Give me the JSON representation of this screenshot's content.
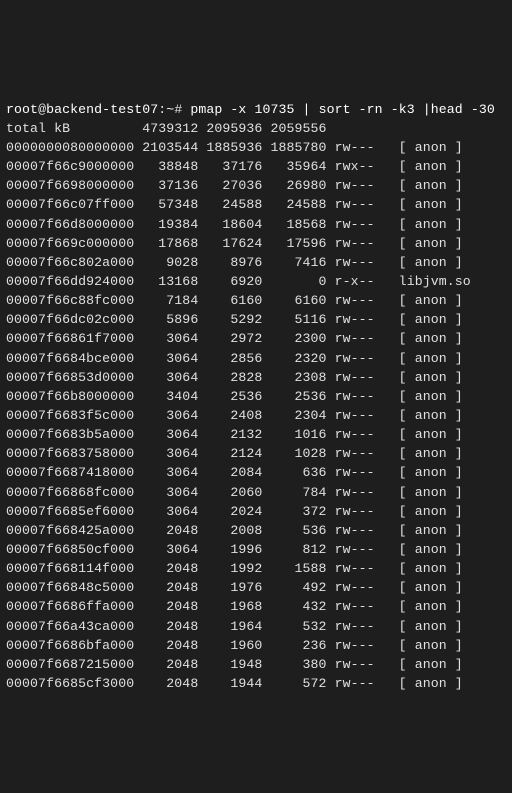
{
  "prompt": {
    "user": "root",
    "host": "backend-test07",
    "path": "~",
    "symbol": "#",
    "command": "pmap -x 10735 | sort -rn -k3 |head -30"
  },
  "header": {
    "label": "total kB",
    "c1": "4739312",
    "c2": "2095936",
    "c3": "2059556"
  },
  "rows": [
    {
      "addr": "0000000080000000",
      "c1": "2103544",
      "c2": "1885936",
      "c3": "1885780",
      "mode": "rw---",
      "map": "[ anon ]"
    },
    {
      "addr": "00007f66c9000000",
      "c1": "38848",
      "c2": "37176",
      "c3": "35964",
      "mode": "rwx--",
      "map": "[ anon ]"
    },
    {
      "addr": "00007f6698000000",
      "c1": "37136",
      "c2": "27036",
      "c3": "26980",
      "mode": "rw---",
      "map": "[ anon ]"
    },
    {
      "addr": "00007f66c07ff000",
      "c1": "57348",
      "c2": "24588",
      "c3": "24588",
      "mode": "rw---",
      "map": "[ anon ]"
    },
    {
      "addr": "00007f66d8000000",
      "c1": "19384",
      "c2": "18604",
      "c3": "18568",
      "mode": "rw---",
      "map": "[ anon ]"
    },
    {
      "addr": "00007f669c000000",
      "c1": "17868",
      "c2": "17624",
      "c3": "17596",
      "mode": "rw---",
      "map": "[ anon ]"
    },
    {
      "addr": "00007f66c802a000",
      "c1": "9028",
      "c2": "8976",
      "c3": "7416",
      "mode": "rw---",
      "map": "[ anon ]"
    },
    {
      "addr": "00007f66dd924000",
      "c1": "13168",
      "c2": "6920",
      "c3": "0",
      "mode": "r-x--",
      "map": "libjvm.so"
    },
    {
      "addr": "00007f66c88fc000",
      "c1": "7184",
      "c2": "6160",
      "c3": "6160",
      "mode": "rw---",
      "map": "[ anon ]"
    },
    {
      "addr": "00007f66dc02c000",
      "c1": "5896",
      "c2": "5292",
      "c3": "5116",
      "mode": "rw---",
      "map": "[ anon ]"
    },
    {
      "addr": "00007f66861f7000",
      "c1": "3064",
      "c2": "2972",
      "c3": "2300",
      "mode": "rw---",
      "map": "[ anon ]"
    },
    {
      "addr": "00007f6684bce000",
      "c1": "3064",
      "c2": "2856",
      "c3": "2320",
      "mode": "rw---",
      "map": "[ anon ]"
    },
    {
      "addr": "00007f66853d0000",
      "c1": "3064",
      "c2": "2828",
      "c3": "2308",
      "mode": "rw---",
      "map": "[ anon ]"
    },
    {
      "addr": "00007f66b8000000",
      "c1": "3404",
      "c2": "2536",
      "c3": "2536",
      "mode": "rw---",
      "map": "[ anon ]"
    },
    {
      "addr": "00007f6683f5c000",
      "c1": "3064",
      "c2": "2408",
      "c3": "2304",
      "mode": "rw---",
      "map": "[ anon ]"
    },
    {
      "addr": "00007f6683b5a000",
      "c1": "3064",
      "c2": "2132",
      "c3": "1016",
      "mode": "rw---",
      "map": "[ anon ]"
    },
    {
      "addr": "00007f6683758000",
      "c1": "3064",
      "c2": "2124",
      "c3": "1028",
      "mode": "rw---",
      "map": "[ anon ]"
    },
    {
      "addr": "00007f6687418000",
      "c1": "3064",
      "c2": "2084",
      "c3": "636",
      "mode": "rw---",
      "map": "[ anon ]"
    },
    {
      "addr": "00007f66868fc000",
      "c1": "3064",
      "c2": "2060",
      "c3": "784",
      "mode": "rw---",
      "map": "[ anon ]"
    },
    {
      "addr": "00007f6685ef6000",
      "c1": "3064",
      "c2": "2024",
      "c3": "372",
      "mode": "rw---",
      "map": "[ anon ]"
    },
    {
      "addr": "00007f668425a000",
      "c1": "2048",
      "c2": "2008",
      "c3": "536",
      "mode": "rw---",
      "map": "[ anon ]"
    },
    {
      "addr": "00007f66850cf000",
      "c1": "3064",
      "c2": "1996",
      "c3": "812",
      "mode": "rw---",
      "map": "[ anon ]"
    },
    {
      "addr": "00007f668114f000",
      "c1": "2048",
      "c2": "1992",
      "c3": "1588",
      "mode": "rw---",
      "map": "[ anon ]"
    },
    {
      "addr": "00007f66848c5000",
      "c1": "2048",
      "c2": "1976",
      "c3": "492",
      "mode": "rw---",
      "map": "[ anon ]"
    },
    {
      "addr": "00007f6686ffa000",
      "c1": "2048",
      "c2": "1968",
      "c3": "432",
      "mode": "rw---",
      "map": "[ anon ]"
    },
    {
      "addr": "00007f66a43ca000",
      "c1": "2048",
      "c2": "1964",
      "c3": "532",
      "mode": "rw---",
      "map": "[ anon ]"
    },
    {
      "addr": "00007f6686bfa000",
      "c1": "2048",
      "c2": "1960",
      "c3": "236",
      "mode": "rw---",
      "map": "[ anon ]"
    },
    {
      "addr": "00007f6687215000",
      "c1": "2048",
      "c2": "1948",
      "c3": "380",
      "mode": "rw---",
      "map": "[ anon ]"
    },
    {
      "addr": "00007f6685cf3000",
      "c1": "2048",
      "c2": "1944",
      "c3": "572",
      "mode": "rw---",
      "map": "[ anon ]"
    }
  ]
}
